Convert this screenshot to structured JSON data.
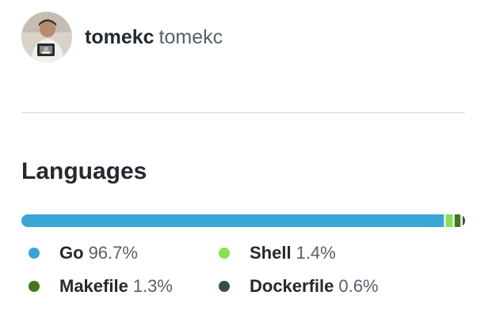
{
  "contributor": {
    "login": "tomekc",
    "name": "tomekc",
    "avatar_icon": "avatar-photo"
  },
  "languages": {
    "title": "Languages",
    "items": [
      {
        "name": "Go",
        "percent": "96.7%",
        "value": 96.7,
        "color": "#3aa5d6"
      },
      {
        "name": "Shell",
        "percent": "1.4%",
        "value": 1.4,
        "color": "#89e051"
      },
      {
        "name": "Makefile",
        "percent": "1.3%",
        "value": 1.3,
        "color": "#427819"
      },
      {
        "name": "Dockerfile",
        "percent": "0.6%",
        "value": 0.6,
        "color": "#384d54"
      }
    ]
  }
}
